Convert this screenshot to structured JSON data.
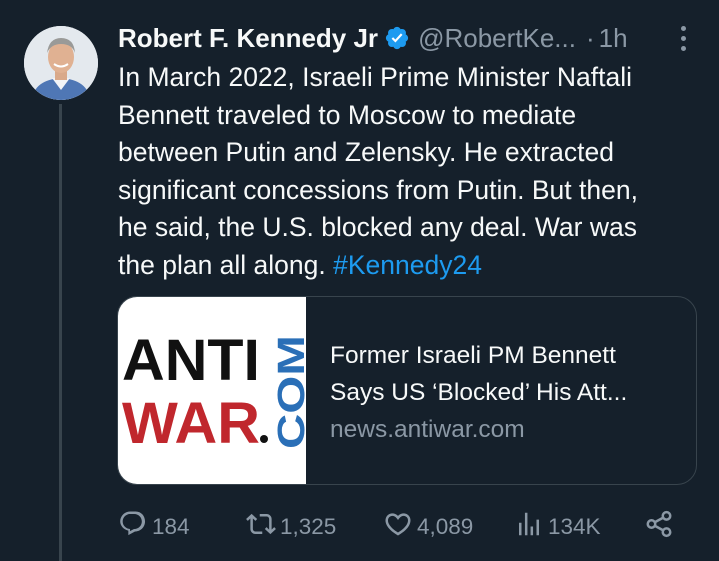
{
  "tweet": {
    "author_name": "Robert F. Kennedy Jr",
    "handle": "@RobertKe...",
    "separator": "·",
    "time": "1h",
    "text_lines": [
      "In March 2022, Israeli Prime Minister Naftali",
      "Bennett traveled to Moscow to mediate",
      "between Putin and Zelensky. He extracted",
      "significant concessions from Putin. But then,",
      "he said, the U.S. blocked any deal. War was",
      "the plan all along. "
    ],
    "hashtag": "#Kennedy24"
  },
  "card": {
    "logo_text": "ANTIWAR.COM",
    "title_line1": "Former Israeli PM Bennett",
    "title_line2": "Says US ‘Blocked’ His Att...",
    "domain": "news.antiwar.com"
  },
  "actions": {
    "replies": "184",
    "reposts": "1,325",
    "likes": "4,089",
    "views": "134K"
  },
  "icons": [
    "verified-icon",
    "more-icon",
    "reply-icon",
    "repost-icon",
    "like-icon",
    "views-icon",
    "share-icon"
  ],
  "colors": {
    "background": "#15202b",
    "accent": "#1d9bf0",
    "secondary_text": "#8b98a5",
    "border": "#38444d",
    "logo_red": "#c0272d",
    "logo_blue": "#2a6fb7"
  }
}
